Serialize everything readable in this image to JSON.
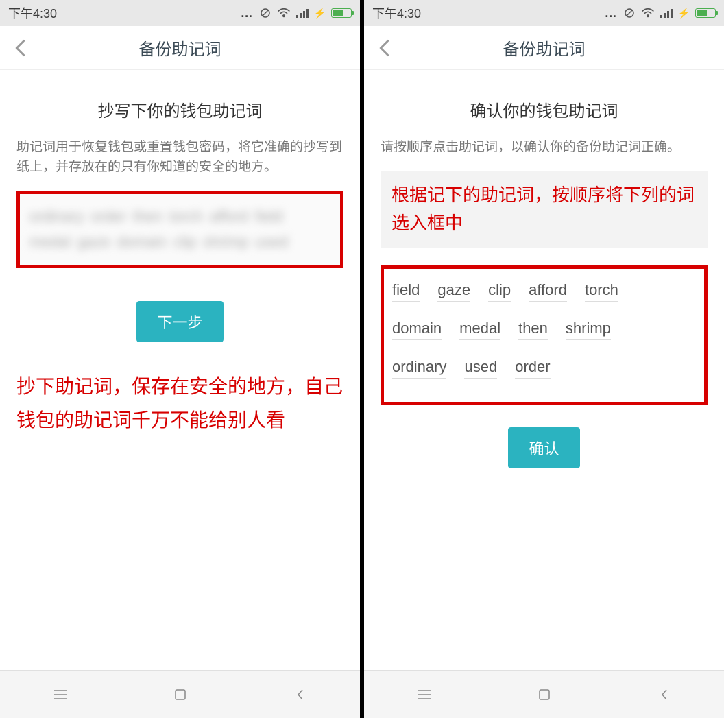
{
  "statusbar": {
    "time": "下午4:30"
  },
  "header": {
    "title": "备份助记词"
  },
  "left": {
    "section_title": "抄写下你的钱包助记词",
    "section_desc": "助记词用于恢复钱包或重置钱包密码，将它准确的抄写到纸上，并存放在的只有你知道的安全的地方。",
    "mnemonic_blurred": "ordinary order then torch afford field medal gaze domain clip shrimp used",
    "next_label": "下一步",
    "annotation": "抄下助记词，保存在安全的地方，自己钱包的助记词千万不能给别人看"
  },
  "right": {
    "section_title": "确认你的钱包助记词",
    "section_desc": "请按顺序点击助记词，以确认你的备份助记词正确。",
    "annotation_box": "根据记下的助记词，按顺序将下列的词选入框中",
    "words": [
      "field",
      "gaze",
      "clip",
      "afford",
      "torch",
      "domain",
      "medal",
      "then",
      "shrimp",
      "ordinary",
      "used",
      "order"
    ],
    "confirm_label": "确认"
  },
  "colors": {
    "accent": "#2bb3c0",
    "danger": "#d70000"
  }
}
